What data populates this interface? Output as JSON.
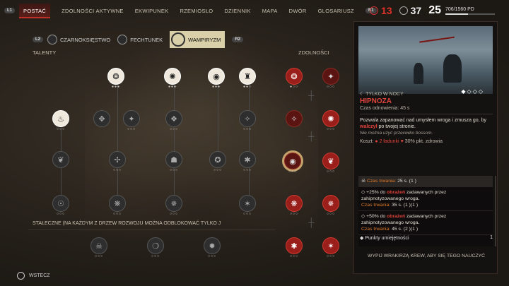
{
  "tabs": {
    "left_key": "L1",
    "right_key": "R1",
    "items": [
      "POSTAĆ",
      "ZDOLNOŚCI AKTYWNE",
      "EKWIPUNEK",
      "RZEMIOSŁO",
      "DZIENNIK",
      "MAPA",
      "DWÓR",
      "GLOSARIUSZ"
    ],
    "active_index": 0
  },
  "stats": {
    "red_count": "13",
    "white_count": "37",
    "level": "25",
    "xp": "706/1560 PD",
    "xp_fraction": 0.45
  },
  "tree_selector": {
    "left_key": "L2",
    "right_key": "R2",
    "items": [
      "CZARNOKSIĘSTWO",
      "FECHTUNEK",
      "WAMPIRYZM"
    ],
    "active": "WAMPIRYZM"
  },
  "sections": {
    "talents": "TALENTY",
    "skills": "ZDOLNOŚCI",
    "permanent_info": "STAŁECZNE (na każdym z drzew rozwoju można odblokować tylko j"
  },
  "back_label": "WSTECZ",
  "panel": {
    "subtitle": "TYLKO W NOCY",
    "title": "HIPNOZA",
    "cooldown": "Czas odnowienia: 45 s",
    "desc_before": "Pozwala zapanować nad umysłem wroga i zmusza go, by ",
    "desc_bold": "walczył",
    "desc_after": " po twojej stronie.",
    "note": "Nie można użyć przeciwko bossom.",
    "cost_label": "Koszt:",
    "cost_blood": "2 ładunki",
    "cost_health": "30% pkt. zdrowia",
    "effects": [
      {
        "label": "Czas trwania:",
        "value": "25 s. (1 )"
      },
      {
        "pre": "+25% do ",
        "bold": "obrażeń",
        "post": " zadawanych przez zahipnotyzowanego wroga.",
        "dur_label": "Czas trwania:",
        "dur_value": "35 s. (1 )(1 )"
      },
      {
        "pre": "+50% do ",
        "bold": "obrażeń",
        "post": " zadawanych przez zahipnotyzowanego wroga.",
        "dur_label": "Czas trwania:",
        "dur_value": "45 s. (2 )(1 )"
      }
    ],
    "points_label": "Punkty umiejętności",
    "points_value": "1",
    "learn_hint": "WYPIJ WRAKIRZĄ  KREW, ABY SIĘ TEGO NAUCZYĆ"
  }
}
